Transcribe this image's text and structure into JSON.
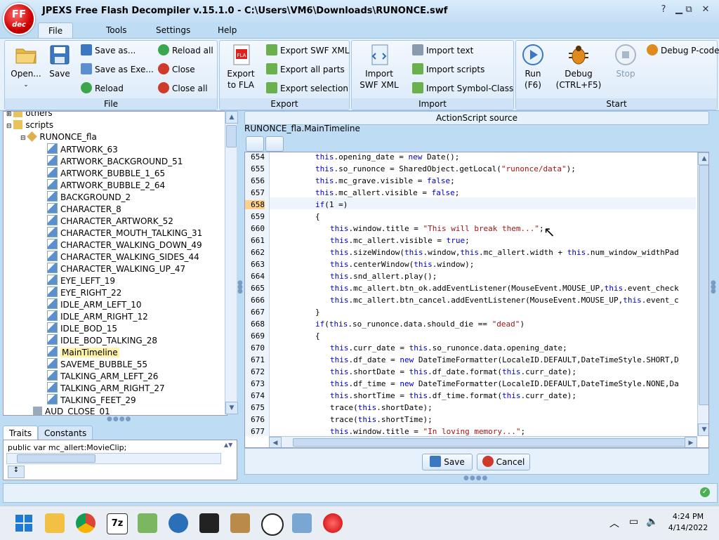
{
  "window": {
    "title": "JPEXS Free Flash Decompiler v.15.1.0 - C:\\Users\\VM6\\Downloads\\RUNONCE.swf",
    "logo_top": "FF",
    "logo_bottom": "dec",
    "buttons": [
      "?",
      "▁",
      "⧉",
      "✕"
    ]
  },
  "menu": {
    "tabs": [
      "File",
      "Tools",
      "Settings",
      "Help"
    ]
  },
  "ribbon": {
    "file": {
      "title": "File",
      "open": "Open...",
      "save": "Save",
      "save_as": "Save as...",
      "save_as_exe": "Save as Exe...",
      "reload": "Reload",
      "reload_all": "Reload all",
      "close": "Close",
      "close_all": "Close all"
    },
    "export": {
      "title": "Export",
      "export_fla_1": "Export",
      "export_fla_2": "to FLA",
      "export_swf_xml": "Export SWF XML",
      "export_all_parts": "Export all parts",
      "export_selection": "Export selection"
    },
    "import": {
      "title": "Import",
      "import_swf_xml_1": "Import",
      "import_swf_xml_2": "SWF XML",
      "import_text": "Import text",
      "import_scripts": "Import scripts",
      "import_symbol_class": "Import Symbol-Class"
    },
    "start": {
      "title": "Start",
      "run_1": "Run",
      "run_2": "(F6)",
      "debug_1": "Debug",
      "debug_2": "(CTRL+F5)",
      "stop": "Stop",
      "debug_pcode": "Debug P-code"
    }
  },
  "tree": {
    "others": "others",
    "scripts": "scripts",
    "runonce_fla": "RUNONCE_fla",
    "items": [
      "ARTWORK_63",
      "ARTWORK_BACKGROUND_51",
      "ARTWORK_BUBBLE_1_65",
      "ARTWORK_BUBBLE_2_64",
      "BACKGROUND_2",
      "CHARACTER_8",
      "CHARACTER_ARTWORK_52",
      "CHARACTER_MOUTH_TALKING_31",
      "CHARACTER_WALKING_DOWN_49",
      "CHARACTER_WALKING_SIDES_44",
      "CHARACTER_WALKING_UP_47",
      "EYE_LEFT_19",
      "EYE_RIGHT_22",
      "IDLE_ARM_LEFT_10",
      "IDLE_ARM_RIGHT_12",
      "IDLE_BOD_15",
      "IDLE_BOD_TALKING_28",
      "MainTimeline",
      "SAVEME_BUBBLE_55",
      "TALKING_ARM_LEFT_26",
      "TALKING_ARM_RIGHT_27",
      "TALKING_FEET_29"
    ],
    "aud_close": "AUD_CLOSE_01"
  },
  "traits": {
    "tab_traits": "Traits",
    "tab_constants": "Constants",
    "line": "public var mc_allert:MovieClip;"
  },
  "source": {
    "panel_title": "ActionScript source",
    "breadcrumb": "RUNONCE_fla.MainTimeline",
    "save": "Save",
    "cancel": "Cancel"
  },
  "code": {
    "lines": [
      {
        "n": "654",
        "indent": 0,
        "text": "this.opening_date = new Date();"
      },
      {
        "n": "655",
        "indent": 0,
        "text": "this.so_runonce = SharedObject.getLocal(\"runonce/data\");"
      },
      {
        "n": "656",
        "indent": 0,
        "text": "this.mc_grave.visible = false;"
      },
      {
        "n": "657",
        "indent": 0,
        "text": "this.mc_allert.visible = false;"
      },
      {
        "n": "658",
        "indent": 0,
        "text": "if(1 =)"
      },
      {
        "n": "659",
        "indent": 0,
        "text": "{"
      },
      {
        "n": "660",
        "indent": 1,
        "text": "this.window.title = \"This will break them...\";"
      },
      {
        "n": "661",
        "indent": 1,
        "text": "this.mc_allert.visible = true;"
      },
      {
        "n": "662",
        "indent": 1,
        "text": "this.sizeWindow(this.window,this.mc_allert.width + this.num_window_widthPad"
      },
      {
        "n": "663",
        "indent": 1,
        "text": "this.centerWindow(this.window);"
      },
      {
        "n": "664",
        "indent": 1,
        "text": "this.snd_allert.play();"
      },
      {
        "n": "665",
        "indent": 1,
        "text": "this.mc_allert.btn_ok.addEventListener(MouseEvent.MOUSE_UP,this.event_check"
      },
      {
        "n": "666",
        "indent": 1,
        "text": "this.mc_allert.btn_cancel.addEventListener(MouseEvent.MOUSE_UP,this.event_c"
      },
      {
        "n": "667",
        "indent": 0,
        "text": "}"
      },
      {
        "n": "668",
        "indent": 0,
        "text": "if(this.so_runonce.data.should_die == \"dead\")"
      },
      {
        "n": "669",
        "indent": 0,
        "text": "{"
      },
      {
        "n": "670",
        "indent": 1,
        "text": "this.curr_date = this.so_runonce.data.opening_date;"
      },
      {
        "n": "671",
        "indent": 1,
        "text": "this.df_date = new DateTimeFormatter(LocaleID.DEFAULT,DateTimeStyle.SHORT,D"
      },
      {
        "n": "672",
        "indent": 1,
        "text": "this.shortDate = this.df_date.format(this.curr_date);"
      },
      {
        "n": "673",
        "indent": 1,
        "text": "this.df_time = new DateTimeFormatter(LocaleID.DEFAULT,DateTimeStyle.NONE,Da"
      },
      {
        "n": "674",
        "indent": 1,
        "text": "this.shortTime = this.df_time.format(this.curr_date);"
      },
      {
        "n": "675",
        "indent": 1,
        "text": "trace(this.shortDate);"
      },
      {
        "n": "676",
        "indent": 1,
        "text": "trace(this.shortTime);"
      },
      {
        "n": "677",
        "indent": 1,
        "text": "this.window.title = \"In loving memory...\";"
      }
    ]
  },
  "taskbar": {
    "time": "4:24 PM",
    "date": "4/14/2022",
    "app_7z": "7z"
  },
  "colors": {
    "accent": "#2b6fb8",
    "selected": "#fff3a8",
    "current_line": "#ffd08a"
  }
}
